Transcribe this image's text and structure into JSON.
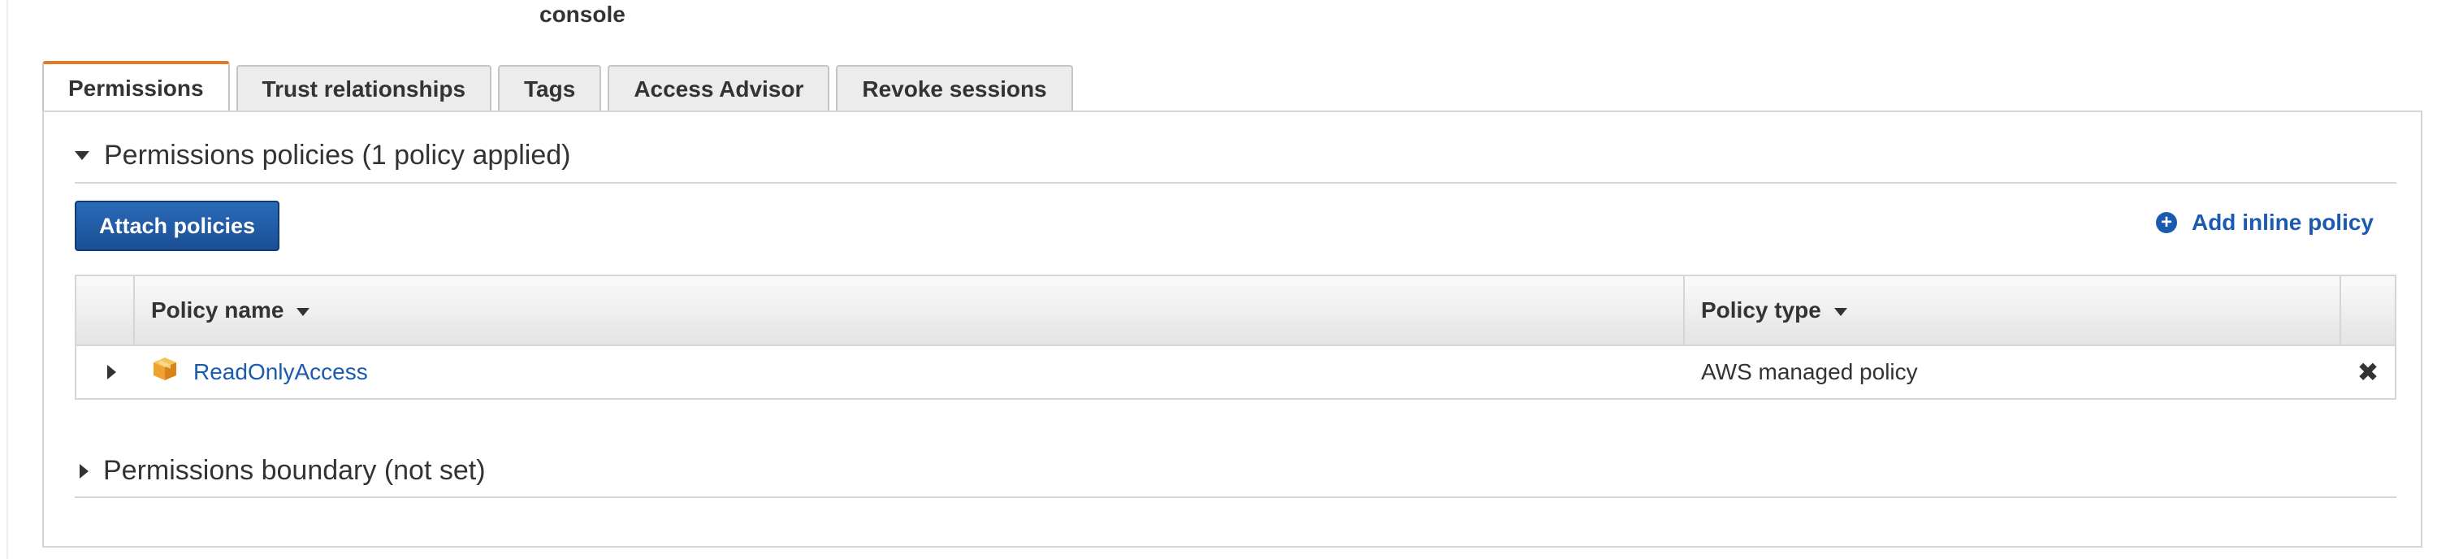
{
  "header": {
    "title": "console"
  },
  "tabs": [
    {
      "label": "Permissions",
      "active": true
    },
    {
      "label": "Trust relationships",
      "active": false
    },
    {
      "label": "Tags",
      "active": false
    },
    {
      "label": "Access Advisor",
      "active": false
    },
    {
      "label": "Revoke sessions",
      "active": false
    }
  ],
  "permissions_policies": {
    "heading": "Permissions policies (1 policy applied)",
    "expanded": true,
    "attach_button": "Attach policies",
    "add_inline_link": "Add inline policy",
    "table": {
      "columns": [
        "Policy name",
        "Policy type"
      ],
      "rows": [
        {
          "name": "ReadOnlyAccess",
          "type": "AWS managed policy",
          "icon": "aws-managed-policy-icon"
        }
      ]
    }
  },
  "permissions_boundary": {
    "heading": "Permissions boundary (not set)",
    "expanded": false
  },
  "colors": {
    "primary_button": "#1e5aa8",
    "link": "#1a5bb0",
    "active_tab_accent": "#e07b24",
    "policy_icon": "#f0a32c"
  },
  "icons": {
    "add_inline": "plus-circle-icon",
    "remove": "close-icon",
    "expand_row": "caret-right-icon",
    "section_collapse": "caret-down-icon",
    "sort": "caret-down-icon"
  }
}
